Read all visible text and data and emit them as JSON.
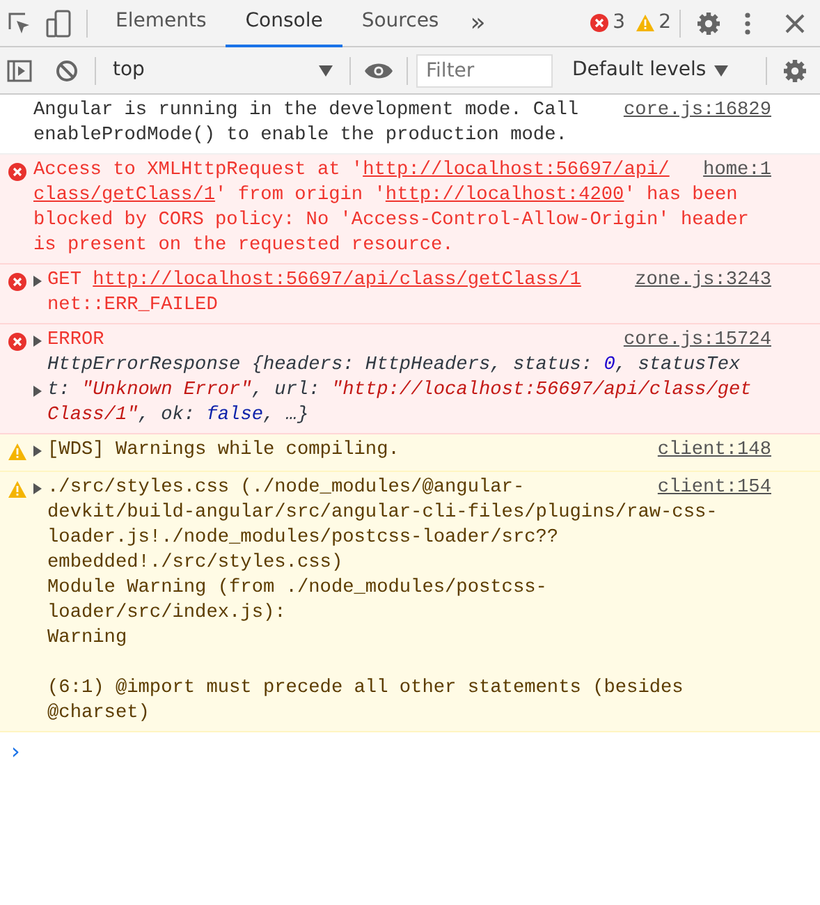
{
  "tabs": [
    {
      "label": "Elements",
      "selected": false
    },
    {
      "label": "Console",
      "selected": true
    },
    {
      "label": "Sources",
      "selected": false
    }
  ],
  "overflow": "»",
  "counts": {
    "errors": "3",
    "warnings": "2"
  },
  "toolbar": {
    "context": "top",
    "filter_placeholder": "Filter",
    "levels": "Default levels"
  },
  "messages": [
    {
      "kind": "info",
      "source": "core.js:16829",
      "lines": [
        {
          "toggle": false,
          "parts": [
            {
              "kind": "text",
              "text": "Angular is running in the development mode. Call"
            }
          ]
        },
        {
          "toggle": false,
          "parts": [
            {
              "kind": "text",
              "text": "enableProdMode() to enable the production mode."
            }
          ]
        }
      ]
    },
    {
      "kind": "error",
      "source": "home:1",
      "lines": [
        {
          "toggle": false,
          "parts": [
            {
              "kind": "text",
              "text": "Access to XMLHttpRequest at '"
            },
            {
              "kind": "link",
              "text": "http://localhost:56697/api/"
            }
          ]
        },
        {
          "toggle": false,
          "parts": [
            {
              "kind": "link",
              "text": "class/getClass/1"
            },
            {
              "kind": "text",
              "text": "' from origin '"
            },
            {
              "kind": "link",
              "text": "http://localhost:4200"
            },
            {
              "kind": "text",
              "text": "' has been"
            }
          ]
        },
        {
          "toggle": false,
          "parts": [
            {
              "kind": "text",
              "text": "blocked by CORS policy: No 'Access-Control-Allow-Origin' header"
            }
          ]
        },
        {
          "toggle": false,
          "parts": [
            {
              "kind": "text",
              "text": "is present on the requested resource."
            }
          ]
        }
      ]
    },
    {
      "kind": "error",
      "source": "zone.js:3243",
      "lines": [
        {
          "toggle": true,
          "parts": [
            {
              "kind": "text",
              "text": "GET "
            },
            {
              "kind": "link",
              "text": "http://localhost:56697/api/class/getClass/1"
            }
          ]
        },
        {
          "toggle": false,
          "parts": [
            {
              "kind": "text",
              "text": "net::ERR_FAILED"
            }
          ]
        }
      ]
    },
    {
      "kind": "error",
      "source": "core.js:15724",
      "lines": [
        {
          "toggle": true,
          "parts": [
            {
              "kind": "text",
              "text": "ERROR"
            }
          ]
        },
        {
          "toggle": false,
          "parts": [
            {
              "kind": "key",
              "text": "HttpErrorResponse {headers: HttpHeaders, status: "
            },
            {
              "kind": "number",
              "text": "0"
            },
            {
              "kind": "key",
              "text": ", statusTex"
            }
          ]
        },
        {
          "toggle": true,
          "parts": [
            {
              "kind": "key",
              "text": "t: "
            },
            {
              "kind": "string",
              "text": "\"Unknown Error\""
            },
            {
              "kind": "key",
              "text": ", url: "
            },
            {
              "kind": "string",
              "text": "\"http://localhost:56697/api/class/get"
            }
          ]
        },
        {
          "toggle": false,
          "parts": [
            {
              "kind": "string",
              "text": "Class/1\""
            },
            {
              "kind": "key",
              "text": ", ok: "
            },
            {
              "kind": "bool",
              "text": "false"
            },
            {
              "kind": "key",
              "text": ", …}"
            }
          ]
        }
      ]
    },
    {
      "kind": "warning",
      "source": "client:148",
      "lines": [
        {
          "toggle": true,
          "parts": [
            {
              "kind": "text",
              "text": "[WDS] Warnings while compiling."
            }
          ]
        }
      ]
    },
    {
      "kind": "warning",
      "source": "client:154",
      "lines": [
        {
          "toggle": true,
          "parts": [
            {
              "kind": "text",
              "text": "./src/styles.css (./node_modules/@angular-"
            }
          ]
        },
        {
          "toggle": false,
          "parts": [
            {
              "kind": "text",
              "text": "devkit/build-angular/src/angular-cli-files/plugins/raw-css-"
            }
          ]
        },
        {
          "toggle": false,
          "parts": [
            {
              "kind": "text",
              "text": "loader.js!./node_modules/postcss-loader/src??"
            }
          ]
        },
        {
          "toggle": false,
          "parts": [
            {
              "kind": "text",
              "text": "embedded!./src/styles.css)"
            }
          ]
        },
        {
          "toggle": false,
          "parts": [
            {
              "kind": "text",
              "text": "Module Warning (from ./node_modules/postcss-"
            }
          ]
        },
        {
          "toggle": false,
          "parts": [
            {
              "kind": "text",
              "text": "loader/src/index.js):"
            }
          ]
        },
        {
          "toggle": false,
          "parts": [
            {
              "kind": "text",
              "text": "Warning"
            }
          ]
        },
        {
          "toggle": false
        },
        {
          "toggle": false,
          "parts": [
            {
              "kind": "text",
              "text": "(6:1) @import must precede all other statements (besides"
            }
          ]
        },
        {
          "toggle": false,
          "parts": [
            {
              "kind": "text",
              "text": "@charset)"
            }
          ]
        }
      ]
    }
  ],
  "prompt": "›"
}
